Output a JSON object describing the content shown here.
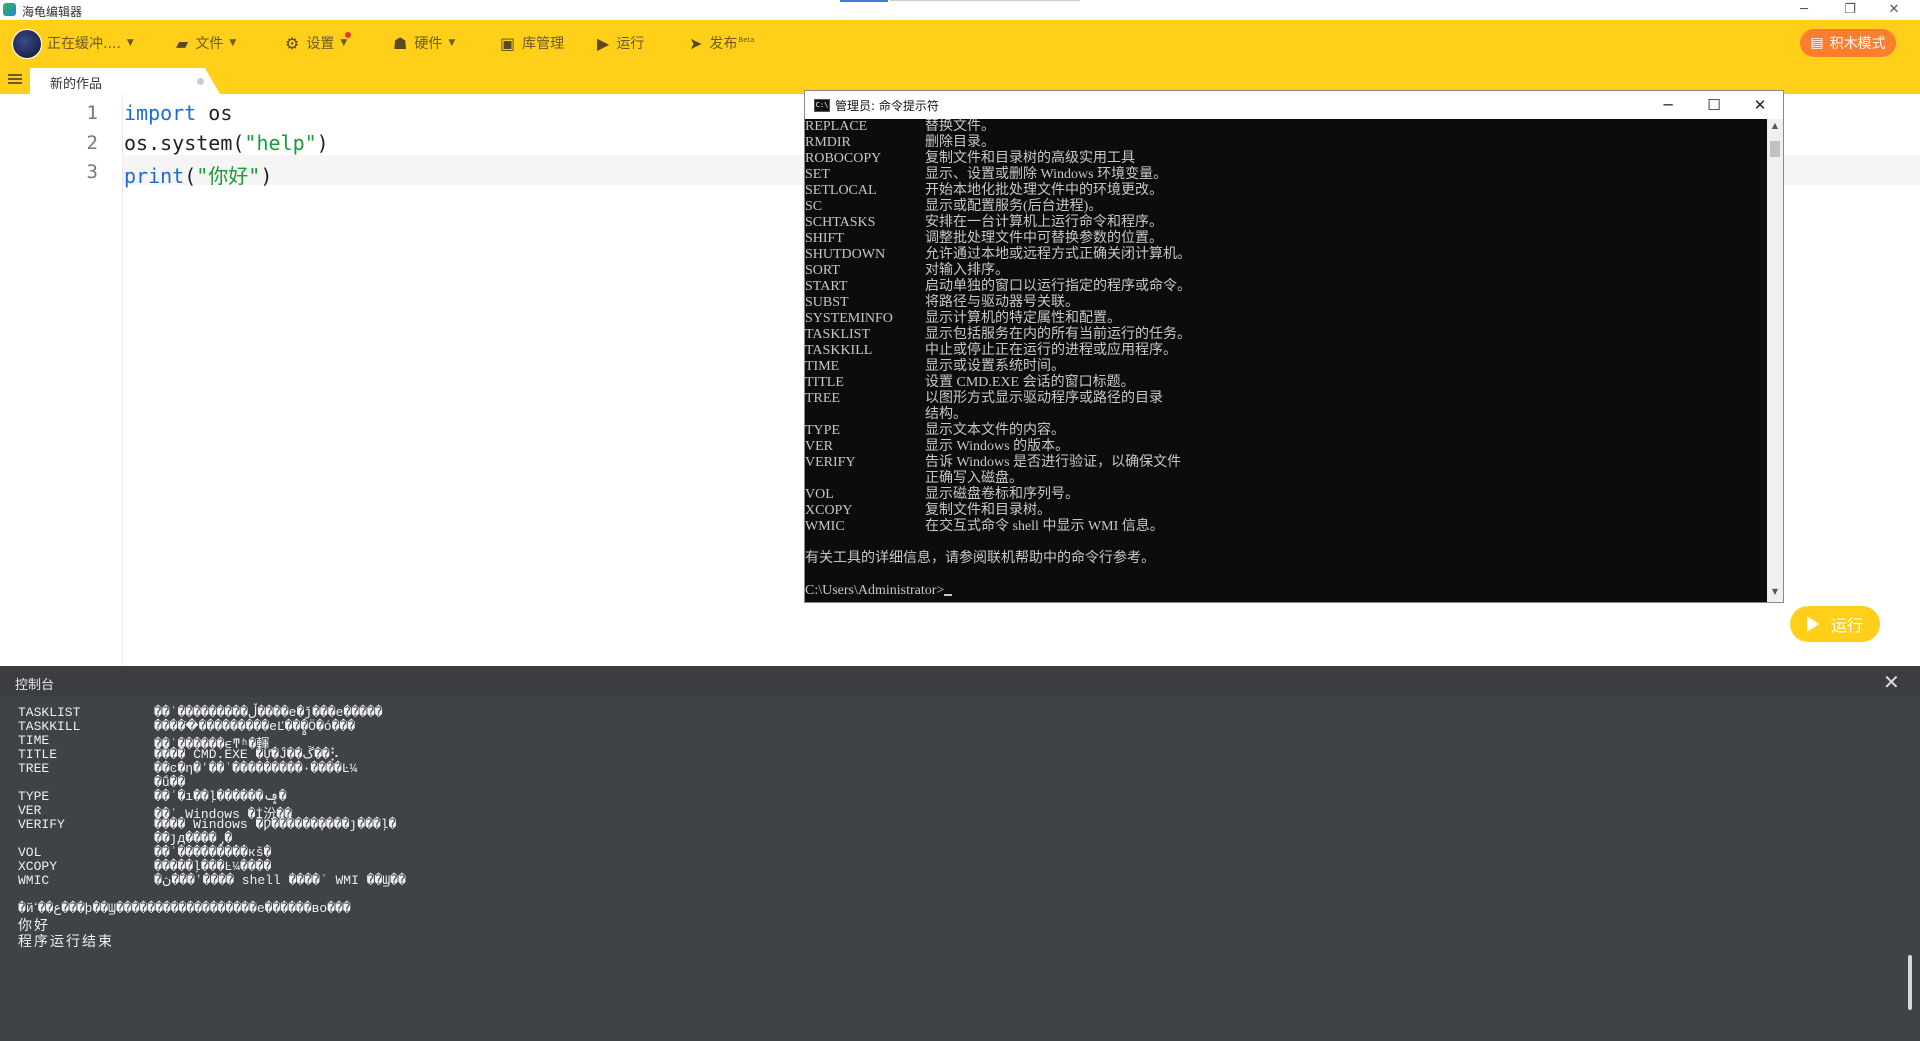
{
  "window": {
    "title": "海龟编辑器",
    "controls": [
      "─",
      "❐",
      "✕"
    ]
  },
  "toolbar": {
    "status_label": "正在缓冲....",
    "file_label": "文件",
    "settings_label": "设置",
    "hardware_label": "硬件",
    "library_label": "库管理",
    "run_label": "运行",
    "publish_label": "发布",
    "publish_badge": "Beta",
    "block_mode_label": "积木模式",
    "accent_color": "#ffcf1a",
    "block_mode_color": "#ff7e2e"
  },
  "tab": {
    "name": "新的作品"
  },
  "editor": {
    "line_numbers": [
      "1",
      "2",
      "3"
    ],
    "lines": [
      {
        "keyword": "import",
        "rest": " os"
      },
      {
        "prefix": "os.system(",
        "string": "\"help\"",
        "suffix": ")"
      },
      {
        "keyword": "print",
        "prefix": "(",
        "string": "\"你好\"",
        "suffix": ")"
      }
    ]
  },
  "cmd_window": {
    "title": "管理员: 命令提示符",
    "icon_text": "C:\\",
    "controls": [
      "─",
      "☐",
      "✕"
    ],
    "rows": [
      [
        "REPLACE",
        "替换文件。"
      ],
      [
        "RMDIR",
        "删除目录。"
      ],
      [
        "ROBOCOPY",
        "复制文件和目录树的高级实用工具"
      ],
      [
        "SET",
        "显示、设置或删除 Windows 环境变量。"
      ],
      [
        "SETLOCAL",
        "开始本地化批处理文件中的环境更改。"
      ],
      [
        "SC",
        "显示或配置服务(后台进程)。"
      ],
      [
        "SCHTASKS",
        "安排在一台计算机上运行命令和程序。"
      ],
      [
        "SHIFT",
        "调整批处理文件中可替换参数的位置。"
      ],
      [
        "SHUTDOWN",
        "允许通过本地或远程方式正确关闭计算机。"
      ],
      [
        "SORT",
        "对输入排序。"
      ],
      [
        "START",
        "启动单独的窗口以运行指定的程序或命令。"
      ],
      [
        "SUBST",
        "将路径与驱动器号关联。"
      ],
      [
        "SYSTEMINFO",
        "显示计算机的特定属性和配置。"
      ],
      [
        "TASKLIST",
        "显示包括服务在内的所有当前运行的任务。"
      ],
      [
        "TASKKILL",
        "中止或停止正在运行的进程或应用程序。"
      ],
      [
        "TIME",
        "显示或设置系统时间。"
      ],
      [
        "TITLE",
        "设置 CMD.EXE 会话的窗口标题。"
      ],
      [
        "TREE",
        "以图形方式显示驱动程序或路径的目录"
      ],
      [
        "",
        "结构。"
      ],
      [
        "TYPE",
        "显示文本文件的内容。"
      ],
      [
        "VER",
        "显示 Windows 的版本。"
      ],
      [
        "VERIFY",
        "告诉 Windows 是否进行验证，以确保文件"
      ],
      [
        "",
        "正确写入磁盘。"
      ],
      [
        "VOL",
        "显示磁盘卷标和序列号。"
      ],
      [
        "XCOPY",
        "复制文件和目录树。"
      ],
      [
        "WMIC",
        "在交互式命令 shell 中显示 WMI 信息。"
      ]
    ],
    "footer_text": "有关工具的详细信息，请参阅联机帮助中的命令行参考。",
    "prompt": "C:\\Users\\Administrator>"
  },
  "run_button": {
    "label": "运行"
  },
  "console": {
    "title": "控制台",
    "rows": [
      [
        "TASKLIST",
        "��ʾ���������ڵ����е�ǰ���е�����"
      ],
      [
        "TASKKILL",
        "�����ֹ���������еĽ��̻�Ӧ�ó���"
      ],
      [
        "TIME",
        "��ʾ������ϵͳʱ�䡣"
      ],
      [
        "TITLE",
        "���� CMD.EXE �Ự�Ĵ��ڱ��⡣"
      ],
      [
        "TREE",
        "��ͼ�η�ʽ��ʾ���������·����Ŀ¼"
      ],
      [
        "",
        "�ṹ��"
      ],
      [
        "TYPE",
        "��ʾ�ı��ļ������ݡ�"
      ],
      [
        "VER",
        "��ʾ Windows �İ汾��"
      ],
      [
        "VERIFY",
        "���� Windows �Ƿ������֤����ȷ���ļ�"
      ],
      [
        "",
        "��ȷд����̡�"
      ],
      [
        "VOL",
        "��ʾ���̾������кš�"
      ],
      [
        "XCOPY",
        "�����ļ���Ŀ¼����"
      ],
      [
        "WMIC",
        "�ڽ���ʽ���� shell ����ʾ WMI ��Ϣ��"
      ]
    ],
    "footer_garbled": "�йع��ߵ���ϸ��Ϣ������������������е������вο���",
    "output_line": "你好",
    "end_line": "程序运行结束"
  }
}
